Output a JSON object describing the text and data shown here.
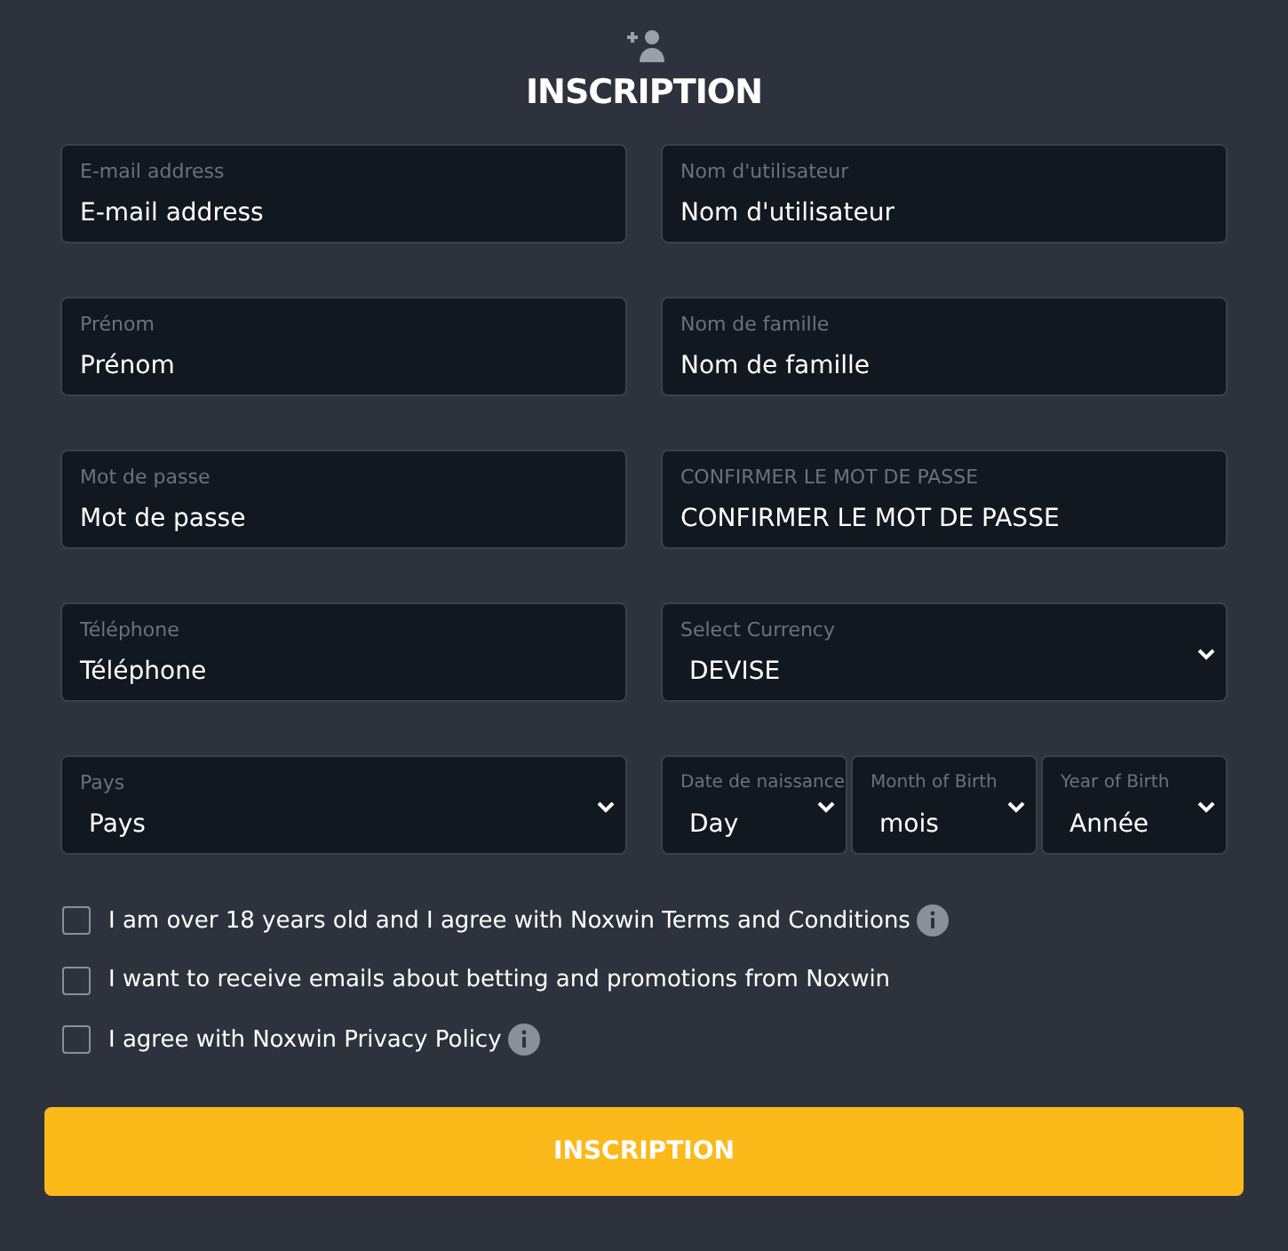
{
  "title": "INSCRIPTION",
  "rows": [
    [
      [
        {
          "kind": "input",
          "label": "E-mail address",
          "value": "E-mail address"
        }
      ],
      [
        {
          "kind": "input",
          "label": "Nom d'utilisateur",
          "value": "Nom d'utilisateur"
        }
      ]
    ],
    [
      [
        {
          "kind": "input",
          "label": "Prénom",
          "value": "Prénom"
        }
      ],
      [
        {
          "kind": "input",
          "label": "Nom de famille",
          "value": "Nom de famille"
        }
      ]
    ],
    [
      [
        {
          "kind": "input",
          "label": "Mot de passe",
          "value": "Mot de passe"
        }
      ],
      [
        {
          "kind": "input",
          "label": "CONFIRMER LE MOT DE PASSE",
          "value": "CONFIRMER LE MOT DE PASSE"
        }
      ]
    ],
    [
      [
        {
          "kind": "input",
          "label": "Téléphone",
          "value": "Téléphone"
        }
      ],
      [
        {
          "kind": "select",
          "label": "Select Currency",
          "value": "DEVISE"
        }
      ]
    ],
    [
      [
        {
          "kind": "select",
          "label": "Pays",
          "value": "Pays"
        }
      ],
      [
        {
          "kind": "select",
          "label": "Date de naissance",
          "value": "Day"
        },
        {
          "kind": "select",
          "label": "Month of Birth",
          "value": "mois"
        },
        {
          "kind": "select",
          "label": "Year of Birth",
          "value": "Année"
        }
      ]
    ]
  ],
  "checkboxes": [
    {
      "label": "I am over 18 years old and I agree with Noxwin Terms and Conditions",
      "checked": false,
      "info": true
    },
    {
      "label": "I want to receive emails about betting and promotions from Noxwin",
      "checked": false,
      "info": false
    },
    {
      "label": "I agree with Noxwin Privacy Policy",
      "checked": false,
      "info": true
    }
  ],
  "submit": "INSCRIPTION"
}
